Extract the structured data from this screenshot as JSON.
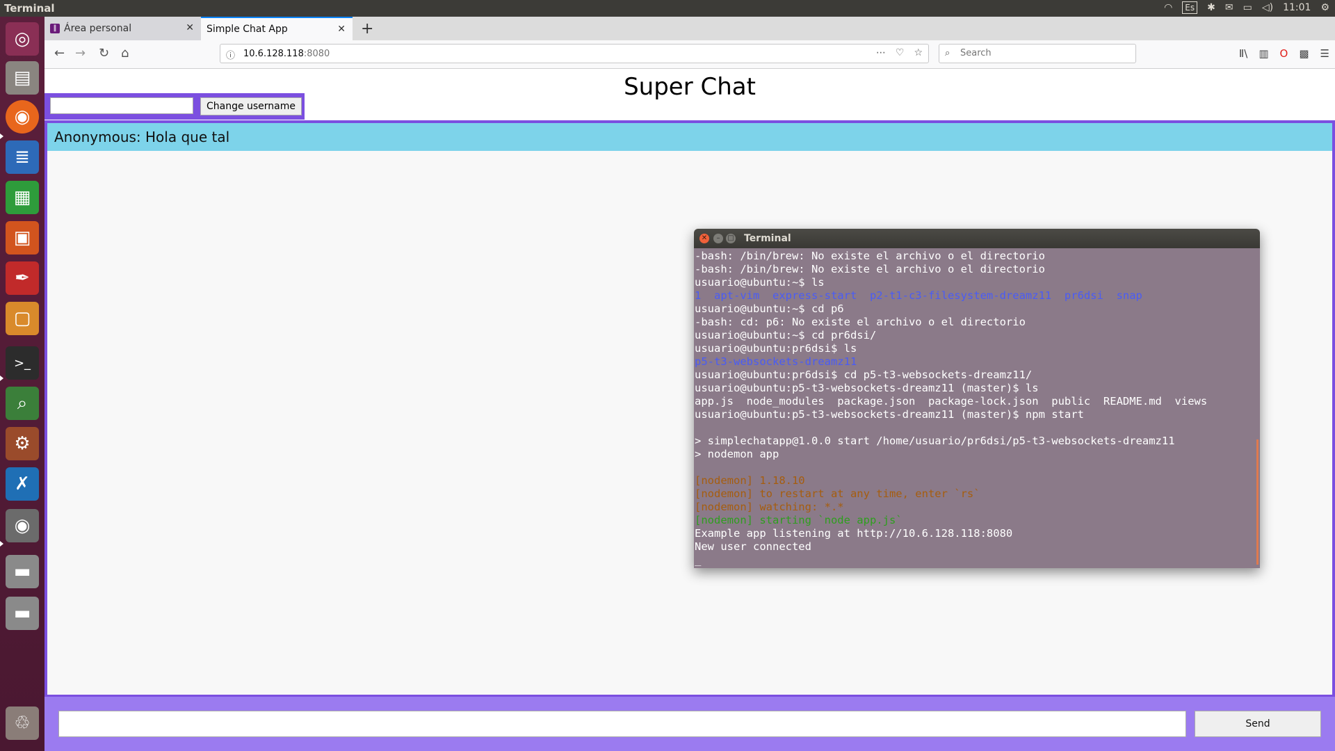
{
  "top_panel": {
    "title": "Terminal",
    "keyboard_layout": "Es",
    "clock": "11:01",
    "icons": [
      "wifi-icon",
      "keyboard-icon",
      "bluetooth-icon",
      "mail-icon",
      "battery-icon",
      "volume-icon",
      "gear-icon"
    ]
  },
  "launcher": {
    "items": [
      "ubuntu-dash",
      "files",
      "firefox",
      "writer",
      "calc",
      "impress",
      "document-viewer",
      "software-center",
      "terminal",
      "image-viewer",
      "settings",
      "vscode",
      "screenshot",
      "drive",
      "drive",
      "trash"
    ]
  },
  "browser": {
    "tabs": [
      {
        "label": "Área personal",
        "active": false
      },
      {
        "label": "Simple Chat App",
        "active": true
      }
    ],
    "url_host": "10.6.128.118",
    "url_port": ":8080",
    "search_placeholder": "Search"
  },
  "chat": {
    "title": "Super Chat",
    "username_value": "",
    "change_username_label": "Change username",
    "messages": [
      "Anonymous: Hola que tal"
    ],
    "message_value": "",
    "send_label": "Send"
  },
  "terminal": {
    "title": "Terminal",
    "lines": [
      "-bash: /bin/brew: No existe el archivo o el directorio",
      "-bash: /bin/brew: No existe el archivo o el directorio",
      "usuario@ubuntu:~$ ls",
      "1  apt-vim  express-start  p2-t1-c3-filesystem-dreamz11  pr6dsi  snap",
      "usuario@ubuntu:~$ cd p6",
      "-bash: cd: p6: No existe el archivo o el directorio",
      "usuario@ubuntu:~$ cd pr6dsi/",
      "usuario@ubuntu:pr6dsi$ ls",
      "p5-t3-websockets-dreamz11",
      "usuario@ubuntu:pr6dsi$ cd p5-t3-websockets-dreamz11/",
      "usuario@ubuntu:p5-t3-websockets-dreamz11 (master)$ ls",
      "app.js  node_modules  package.json  package-lock.json  public  README.md  views",
      "usuario@ubuntu:p5-t3-websockets-dreamz11 (master)$ npm start",
      "",
      "> simplechatapp@1.0.0 start /home/usuario/pr6dsi/p5-t3-websockets-dreamz11",
      "> nodemon app",
      "",
      "[nodemon] 1.18.10",
      "[nodemon] to restart at any time, enter `rs`",
      "[nodemon] watching: *.*",
      "[nodemon] starting `node app.js`",
      "Example app listening at http://10.6.128.118:8080",
      "New user connected",
      "_"
    ],
    "colors": {
      "background": "#8b7a89",
      "text": "#ffffff",
      "directory": "#4a5cf5",
      "nodemon_info": "#a65d0e",
      "nodemon_start": "#2e9e1e"
    }
  },
  "colors": {
    "accent_purple": "#7b4fe0",
    "message_bg": "#7dd3ea",
    "launcher_bg": "#5c1f3c"
  }
}
